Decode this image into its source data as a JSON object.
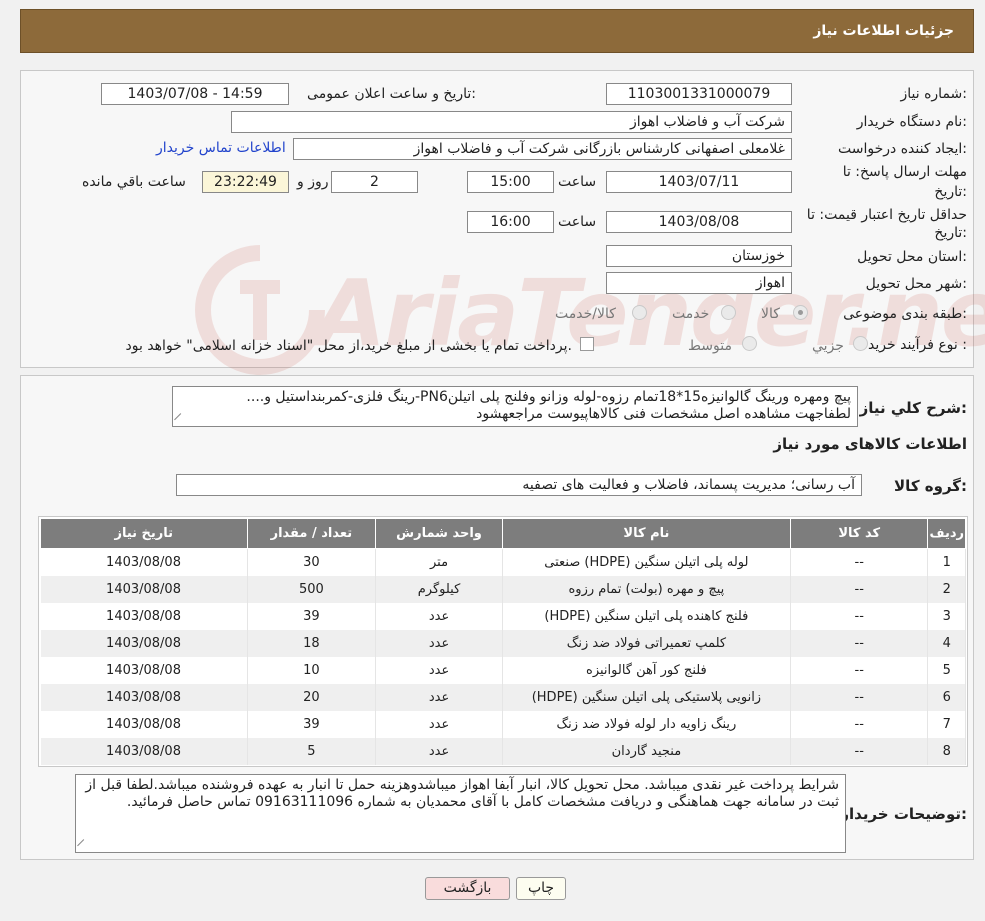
{
  "header": {
    "title": "جزئیات اطلاعات نیاز"
  },
  "form": {
    "need_number_label": "شماره نیاز:",
    "need_number": "1103001331000079",
    "announce_label": "تاریخ و ساعت اعلان عمومی:",
    "announce_value": "1403/07/08 - 14:59",
    "buyer_org_label": "نام دستگاه خریدار:",
    "buyer_org": "شرکت آب و فاضلاب اهواز",
    "creator_label": "ایجاد کننده درخواست:",
    "creator": "غلامعلی اصفهانی کارشناس بازرگانی شرکت آب و فاضلاب اهواز",
    "contact_link": "اطلاعات تماس خریدار",
    "deadline_label_1": "مهلت ارسال پاسخ: تا",
    "deadline_label_2": "تاریخ:",
    "deadline_date": "1403/07/11",
    "time_label": "ساعت",
    "deadline_time": "15:00",
    "days": "2",
    "days_label": "روز و",
    "remaining_time": "23:22:49",
    "remaining_label": "ساعت باقي مانده",
    "validity_label_1": "حداقل تاریخ اعتبار قیمت: تا",
    "validity_label_2": "تاریخ:",
    "validity_date": "1403/08/08",
    "validity_time": "16:00",
    "province_label": "استان محل تحویل:",
    "province": "خوزستان",
    "city_label": "شهر محل تحویل:",
    "city": "اهواز",
    "category_label": "طبقه بندی موضوعی:",
    "category_options": [
      "کالا",
      "خدمت",
      "کالا/خدمت"
    ],
    "process_label": "نوع فرآیند خرید :",
    "process_options": [
      "جزيي",
      "متوسط"
    ],
    "process_note": "پرداخت تمام یا بخشی از مبلغ خرید،از محل \"اسناد خزانه اسلامی\" خواهد بود."
  },
  "watermark": {
    "text": "AriaTender.neT"
  },
  "description": {
    "label": "شرح كلي نياز:",
    "line1": "پیچ ومهره ورینگ گالوانیزه15*18تمام رزوه-لوله وزانو وفلنج پلی اتیلنPN6-رینگ فلزی-کمربنداستیل و....",
    "line2": "لطفاجهت مشاهده اصل مشخصات فنی کالاهاپیوست مراجعهشود"
  },
  "goods": {
    "section_title": "اطلاعات کالاهای مورد نیاز",
    "group_label": "گروه کالا:",
    "group_value": "آب رسانی؛ مدیریت پسماند، فاضلاب و فعالیت های تصفیه"
  },
  "table": {
    "headers": [
      "ردیف",
      "کد کالا",
      "نام کالا",
      "واحد شمارش",
      "تعداد / مقدار",
      "تاریخ نیاز"
    ],
    "rows": [
      [
        "1",
        "--",
        "لوله پلی اتیلن سنگین (HDPE) صنعتی",
        "متر",
        "30",
        "1403/08/08"
      ],
      [
        "2",
        "--",
        "پیچ و مهره (بولت) تمام رزوه",
        "کیلوگرم",
        "500",
        "1403/08/08"
      ],
      [
        "3",
        "--",
        "فلنج کاهنده پلی اتیلن سنگین (HDPE)",
        "عدد",
        "39",
        "1403/08/08"
      ],
      [
        "4",
        "--",
        "کلمپ تعمیراتی فولاد ضد زنگ",
        "عدد",
        "18",
        "1403/08/08"
      ],
      [
        "5",
        "--",
        "فلنج کور آهن گالوانیزه",
        "عدد",
        "10",
        "1403/08/08"
      ],
      [
        "6",
        "--",
        "زانویی پلاستیکی پلی اتیلن سنگین (HDPE)",
        "عدد",
        "20",
        "1403/08/08"
      ],
      [
        "7",
        "--",
        "رینگ زاویه دار لوله فولاد ضد زنگ",
        "عدد",
        "39",
        "1403/08/08"
      ],
      [
        "8",
        "--",
        "منجید گاردان",
        "عدد",
        "5",
        "1403/08/08"
      ]
    ]
  },
  "buyer_notes": {
    "label": "توضیحات خریدار:",
    "text": "شرایط پرداخت غیر نقدی میباشد. محل تحویل کالا، انبار آبفا اهواز میباشدوهزینه حمل تا انبار به عهده فروشنده میباشد.لطفا قبل از ثبت در سامانه جهت هماهنگی و دریافت مشخصات کامل با آقای  محمدیان به شماره 09163111096 تماس حاصل فرمائید."
  },
  "buttons": {
    "print": "چاپ",
    "back": "بازگشت"
  }
}
